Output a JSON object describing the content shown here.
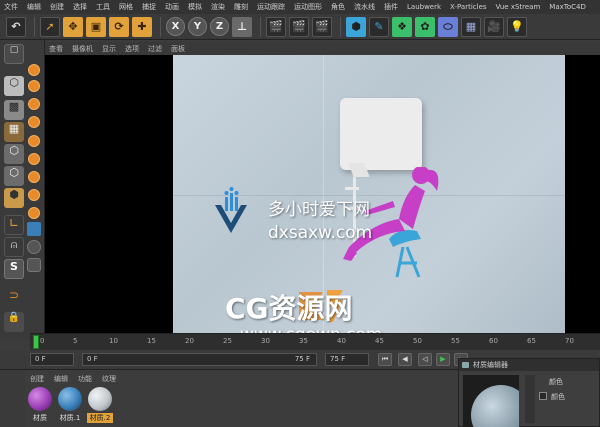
{
  "menu": [
    "文件",
    "编辑",
    "创建",
    "选择",
    "工具",
    "网格",
    "捕捉",
    "动画",
    "模拟",
    "渲染",
    "雕刻",
    "运动跟踪",
    "运动图形",
    "角色",
    "流水线",
    "插件",
    "Laubwerk",
    "X-Particles",
    "Vue xStream",
    "MaxToC4D"
  ],
  "toolbar": {
    "x_label": "X",
    "y_label": "Y",
    "z_label": "Z"
  },
  "viewport": {
    "menu": [
      "查看",
      "摄像机",
      "显示",
      "选项",
      "过滤",
      "面板"
    ],
    "watermark_cn": "多小时爱下网",
    "watermark_url": "dxsaxw.com",
    "cg_title": "CG资源网",
    "cg_url": "www.cgown.com"
  },
  "timeline": {
    "ticks": [
      "0",
      "5",
      "10",
      "15",
      "20",
      "25",
      "30",
      "35",
      "40",
      "45",
      "50",
      "55",
      "60",
      "65",
      "70"
    ]
  },
  "transport": {
    "start_frame": "0 F",
    "range_start": "0 F",
    "range_end": "75 F",
    "end_frame": "75 F"
  },
  "material_manager": {
    "menu": [
      "创建",
      "编辑",
      "功能",
      "纹理"
    ],
    "materials": [
      {
        "name": "材质",
        "color": "#9b3fb5"
      },
      {
        "name": "材质.1",
        "color": "#3a7fb8"
      },
      {
        "name": "材质.2",
        "color": "#c2c8cc"
      }
    ]
  },
  "material_editor": {
    "title": "材质编辑器",
    "section": "颜色",
    "channel": "颜色"
  },
  "colors": {
    "accent_orange": "#e2a23a",
    "playhead_green": "#3fc34a"
  }
}
